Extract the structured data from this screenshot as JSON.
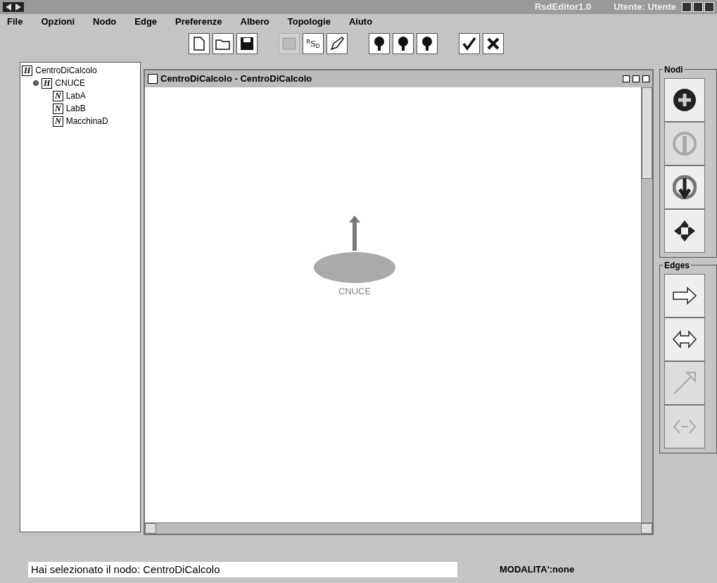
{
  "window": {
    "title": "RsdEditor1.0",
    "user": "Utente: Utente"
  },
  "menu": [
    "File",
    "Opzioni",
    "Nodo",
    "Edge",
    "Preferenze",
    "Albero",
    "Topologie",
    "Aiuto"
  ],
  "toolbar": [
    {
      "kind": "new",
      "disabled": false
    },
    {
      "kind": "open",
      "disabled": false
    },
    {
      "kind": "save",
      "disabled": false
    },
    {
      "kind": "gap"
    },
    {
      "kind": "grid",
      "disabled": true
    },
    {
      "kind": "rsd",
      "label": "$^{R}$S$_{D}$",
      "disabled": false
    },
    {
      "kind": "pen",
      "disabled": false
    },
    {
      "kind": "gap"
    },
    {
      "kind": "tree",
      "disabled": false
    },
    {
      "kind": "tree",
      "disabled": false
    },
    {
      "kind": "tree",
      "disabled": false
    },
    {
      "kind": "gap"
    },
    {
      "kind": "ok",
      "disabled": false
    },
    {
      "kind": "cancel",
      "disabled": false
    }
  ],
  "tree": [
    {
      "badge": "H",
      "label": "CentroDiCalcolo",
      "children": [
        {
          "badge": "H",
          "label": "CNUCE",
          "expanded": true,
          "children": [
            {
              "badge": "N",
              "label": "LabA"
            },
            {
              "badge": "N",
              "label": "LabB"
            },
            {
              "badge": "N",
              "label": "MacchinaD"
            }
          ]
        }
      ]
    }
  ],
  "frame": {
    "title": "CentroDiCalcolo - CentroDiCalcolo",
    "node": {
      "label": "CNUCE"
    }
  },
  "nodes_panel": {
    "title": "Nodi",
    "tools": [
      {
        "kind": "add"
      },
      {
        "kind": "up",
        "disabled": true
      },
      {
        "kind": "down"
      },
      {
        "kind": "delete"
      }
    ]
  },
  "edges_panel": {
    "title": "Edges",
    "tools": [
      {
        "kind": "right"
      },
      {
        "kind": "both"
      },
      {
        "kind": "diagonal",
        "disabled": true
      },
      {
        "kind": "cross",
        "disabled": true
      }
    ]
  },
  "status": {
    "message": "Hai selezionato il nodo:  CentroDiCalcolo",
    "mode": "MODALITA':none"
  }
}
